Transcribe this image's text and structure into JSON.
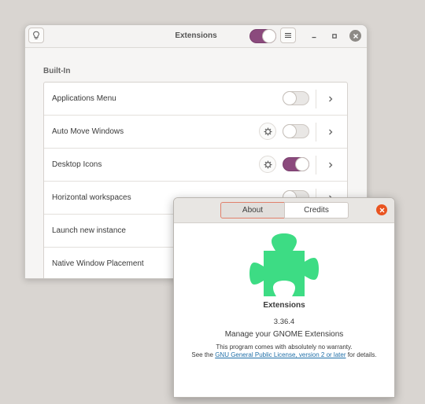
{
  "window": {
    "title": "Extensions",
    "global_switch_on": true
  },
  "section": {
    "title": "Built-In"
  },
  "extensions": [
    {
      "name": "Applications Menu",
      "enabled": false,
      "has_settings": false
    },
    {
      "name": "Auto Move Windows",
      "enabled": false,
      "has_settings": true
    },
    {
      "name": "Desktop Icons",
      "enabled": true,
      "has_settings": true
    },
    {
      "name": "Horizontal workspaces",
      "enabled": false,
      "has_settings": false
    },
    {
      "name": "Launch new instance",
      "enabled": false,
      "has_settings": false
    },
    {
      "name": "Native Window Placement",
      "enabled": false,
      "has_settings": false
    }
  ],
  "about": {
    "tabs": {
      "about": "About",
      "credits": "Credits"
    },
    "active_tab": "about",
    "app_name": "Extensions",
    "version": "3.36.4",
    "comment": "Manage your GNOME Extensions",
    "warranty": "This program comes with absolutely no warranty.",
    "license_prefix": "See the ",
    "license_link": "GNU General Public License, version 2 or later",
    "license_suffix": " for details."
  },
  "colors": {
    "accent": "#8b4a7d",
    "close": "#e95420",
    "puzzle": "#3ddc84",
    "link": "#1f6fa8"
  },
  "icons": {
    "tip": "lightbulb-icon",
    "menu": "hamburger-menu-icon",
    "minimize": "minimize-icon",
    "maximize": "maximize-icon",
    "close": "close-icon",
    "settings": "gear-icon",
    "details": "chevron-right-icon",
    "app": "puzzle-piece-icon"
  }
}
